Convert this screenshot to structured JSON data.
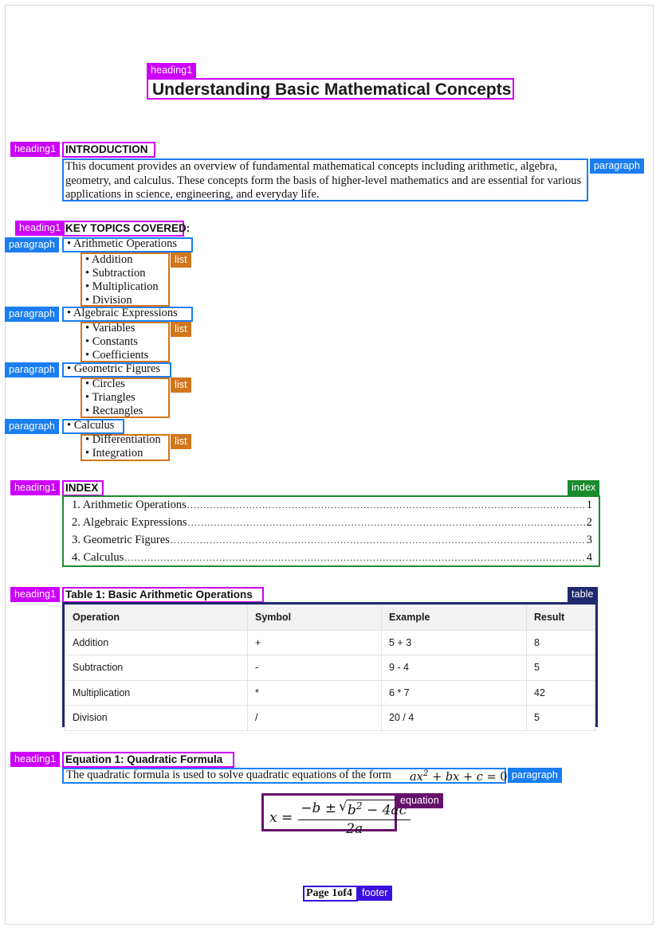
{
  "document": {
    "title": "Understanding Basic Mathematical Concepts",
    "footer": "Page 1of4"
  },
  "labels": {
    "heading1": "heading1",
    "paragraph": "paragraph",
    "list": "list",
    "index": "index",
    "table": "table",
    "equation": "equation",
    "footer": "footer"
  },
  "colors": {
    "heading1": "#cc00fa",
    "paragraph": "#1a7ef0",
    "list": "#d2761b",
    "index": "#1b8b2e",
    "table": "#1f2a6e",
    "equation": "#66126b",
    "footer": "#3a10e0"
  },
  "sections": {
    "introduction": {
      "heading": "INTRODUCTION",
      "paragraph": "This document provides an overview of fundamental mathematical concepts including arithmetic, algebra, geometry, and calculus. These concepts form the basis of higher-level mathematics and are essential for various applications in science, engineering, and everyday life."
    },
    "key_topics": {
      "heading": "KEY TOPICS COVERED:",
      "topics": [
        {
          "title": "Arithmetic Operations",
          "items": [
            "Addition",
            "Subtraction",
            "Multiplication",
            "Division"
          ]
        },
        {
          "title": "Algebraic Expressions",
          "items": [
            "Variables",
            "Constants",
            "Coefficients"
          ]
        },
        {
          "title": "Geometric Figures",
          "items": [
            "Circles",
            "Triangles",
            "Rectangles"
          ]
        },
        {
          "title": "Calculus",
          "items": [
            "Differentiation",
            "Integration"
          ]
        }
      ]
    },
    "index": {
      "heading": "INDEX",
      "entries": [
        {
          "label": "1. Arithmetic Operations",
          "page": "1"
        },
        {
          "label": "2. Algebraic Expressions",
          "page": "2"
        },
        {
          "label": "3. Geometric Figures",
          "page": "3"
        },
        {
          "label": "4. Calculus",
          "page": "4"
        }
      ]
    },
    "table": {
      "heading": "Table 1: Basic Arithmetic Operations",
      "columns": [
        "Operation",
        "Symbol",
        "Example",
        "Result"
      ],
      "rows": [
        [
          "Addition",
          "+",
          "5 + 3",
          "8"
        ],
        [
          "Subtraction",
          "-",
          "9 - 4",
          "5"
        ],
        [
          "Multiplication",
          "*",
          "6 * 7",
          "42"
        ],
        [
          "Division",
          "/",
          "20 / 4",
          "5"
        ]
      ]
    },
    "equation": {
      "heading": "Equation 1: Quadratic Formula",
      "paragraph_prefix": "The quadratic formula is used to solve quadratic equations of the form",
      "inline_math": "ax2 + bx + c = 0.",
      "display_math": "x = (-b ± sqrt(b2 - 4ac)) / 2a",
      "display_parts": {
        "lhs": "x =",
        "numerator_lead": "−b ±",
        "radicand_base": "b",
        "radicand_exp": "2",
        "radicand_tail": "− 4ac",
        "denominator": "2a"
      }
    }
  }
}
